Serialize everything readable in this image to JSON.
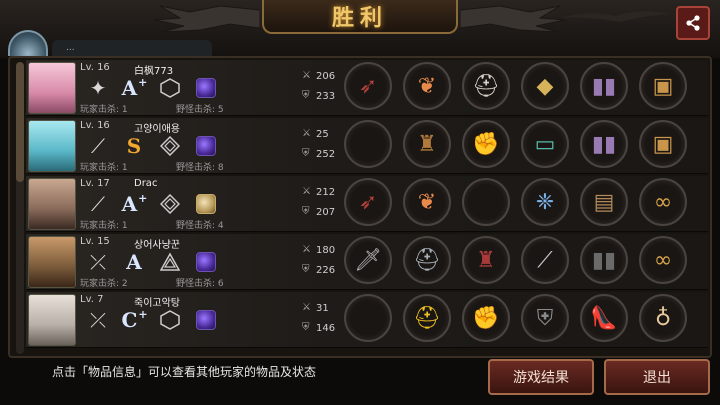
{
  "header": {
    "title": "胜利",
    "team_label": "...",
    "share_icon": "share-icon"
  },
  "players": [
    {
      "level": "Lv. 16",
      "name": "白枫773",
      "grade": "A",
      "grade_plus": "+",
      "player_kills": "玩家击杀: 1",
      "monster_kills": "野怪击杀: 5",
      "attack": "206",
      "defense": "233",
      "weapon_icon": "shuriken-icon",
      "items": [
        "crossbow",
        "wing-crown",
        "helmet",
        "shield",
        "boots",
        "chest"
      ]
    },
    {
      "level": "Lv. 16",
      "name": "고양이애용",
      "grade": "S",
      "grade_plus": "",
      "player_kills": "玩家击杀: 1",
      "monster_kills": "野怪击杀: 8",
      "attack": "25",
      "defense": "252",
      "weapon_icon": "bat-icon",
      "items": [
        "empty",
        "armor",
        "gauntlet",
        "bracelet",
        "boots",
        "chest"
      ]
    },
    {
      "level": "Lv. 17",
      "name": "Drac",
      "grade": "A",
      "grade_plus": "+",
      "player_kills": "玩家击杀: 1",
      "monster_kills": "野怪击杀: 4",
      "attack": "212",
      "defense": "207",
      "weapon_icon": "bat-icon",
      "items": [
        "crossbow",
        "wing-crown",
        "empty",
        "wing-crystal",
        "bracer",
        "goggles"
      ]
    },
    {
      "level": "Lv. 15",
      "name": "상어사냥꾼",
      "grade": "A",
      "grade_plus": "",
      "player_kills": "玩家击杀: 2",
      "monster_kills": "野怪击杀: 6",
      "attack": "180",
      "defense": "226",
      "weapon_icon": "rapier-icon",
      "items": [
        "dagger",
        "helmet",
        "armor",
        "blade",
        "boots",
        "goggles"
      ]
    },
    {
      "level": "Lv. 7",
      "name": "죽이고악탕",
      "grade": "C",
      "grade_plus": "+",
      "player_kills": "",
      "monster_kills": "",
      "attack": "31",
      "defense": "146",
      "weapon_icon": "rapier-icon",
      "items": [
        "empty",
        "hard-hat",
        "gauntlet",
        "shield",
        "heels",
        "racket"
      ]
    }
  ],
  "footer": {
    "hint": "点击「物品信息」可以查看其他玩家的物品及状态",
    "results_button": "游戏结果",
    "exit_button": "退出"
  },
  "colors": {
    "accent_gold": "#f0c76a",
    "button_red": "#6a2a22",
    "grade_s": "#f0a830"
  }
}
